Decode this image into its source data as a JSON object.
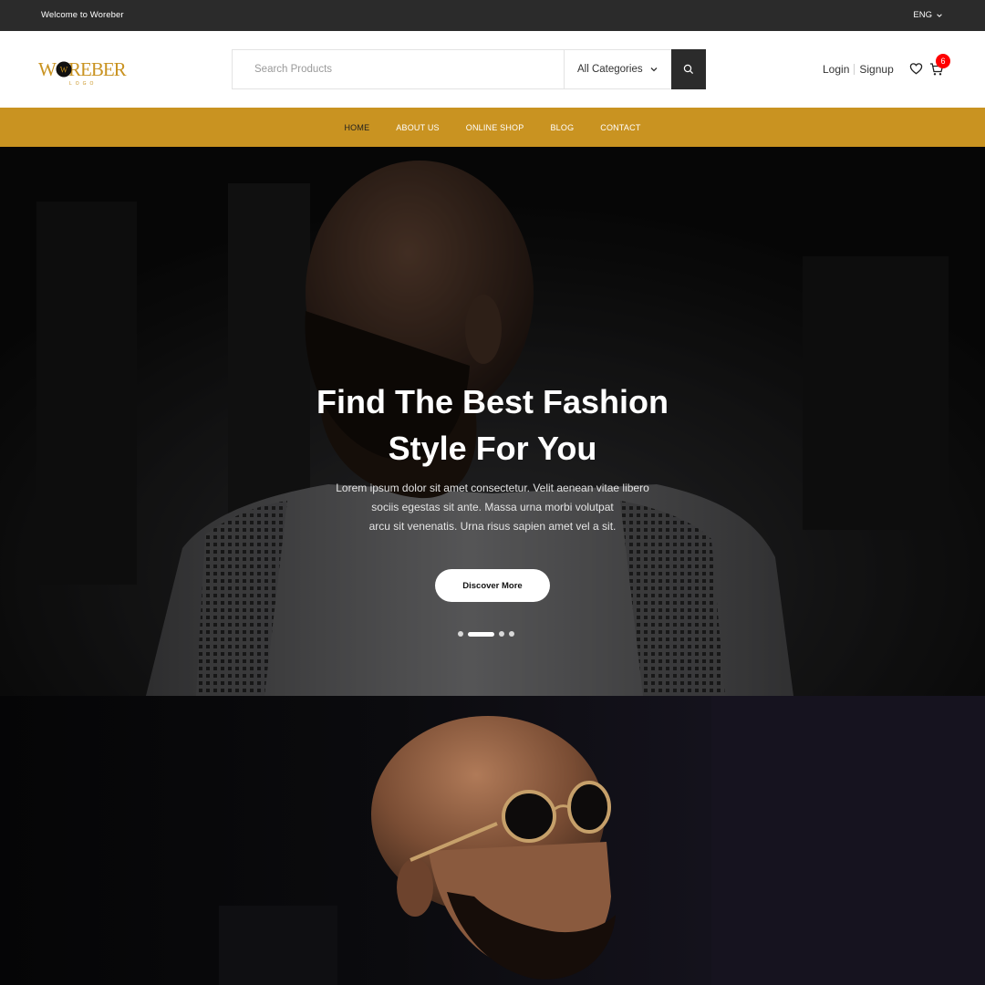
{
  "topbar": {
    "welcome": "Welcome to Woreber",
    "language": "ENG"
  },
  "brand": {
    "logo_text": "WOREBER",
    "logo_sub": "LOGO",
    "accent": "#c99321"
  },
  "search": {
    "placeholder": "Search Products",
    "category": "All Categories"
  },
  "account": {
    "login": "Login",
    "signup": "Signup",
    "cart_count": "6"
  },
  "nav": {
    "items": [
      "HOME",
      "ABOUT US",
      "ONLINE SHOP",
      "BLOG",
      "CONTACT"
    ],
    "active": "HOME"
  },
  "hero": {
    "title_line1": "Find The Best Fashion",
    "title_line2": "Style For You",
    "text_line1": "Lorem ipsum dolor sit amet consectetur. Velit aenean vitae libero",
    "text_line2": "sociis egestas sit ante. Massa urna morbi volutpat",
    "text_line3": "arcu sit venenatis. Urna risus sapien amet vel a sit.",
    "cta": "Discover More",
    "slides": 4,
    "active_slide": 2
  },
  "colors": {
    "topbar": "#2b2b2b",
    "nav": "#c99321",
    "badge": "#ff0000",
    "search_button": "#2b2b2b"
  }
}
